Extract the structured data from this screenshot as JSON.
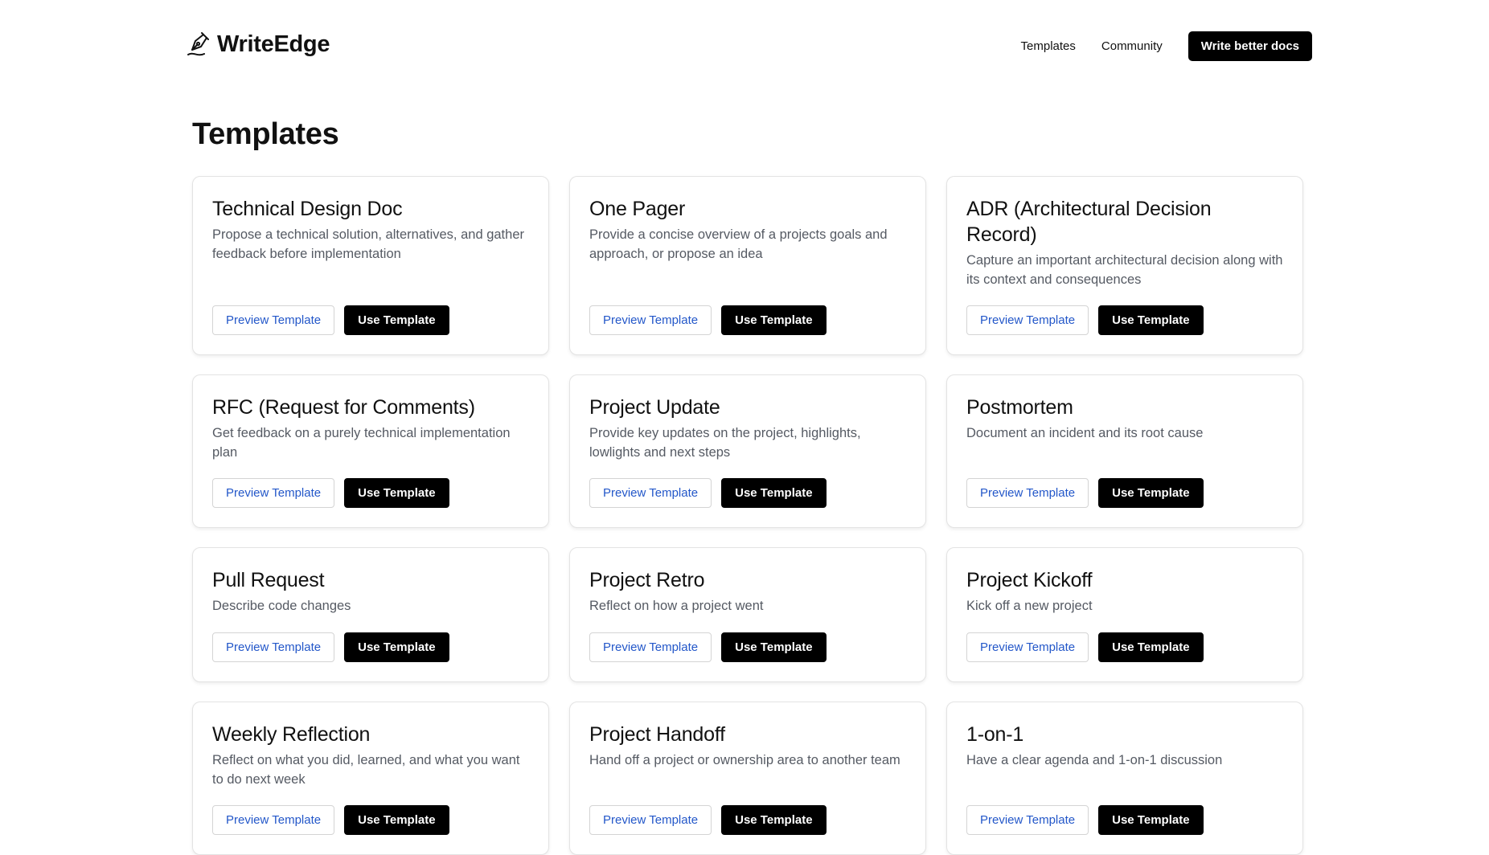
{
  "brand": {
    "name": "WriteEdge",
    "icon": "pen-nib-icon"
  },
  "nav": {
    "links": [
      {
        "label": "Templates"
      },
      {
        "label": "Community"
      }
    ],
    "cta_label": "Write better docs"
  },
  "page": {
    "title": "Templates"
  },
  "colors": {
    "accent_link": "#2357c9",
    "primary_button": "#000000",
    "description_text": "#555a63"
  },
  "templates": [
    {
      "title": "Technical Design Doc",
      "description": "Propose a technical solution, alternatives, and gather feedback before implementation",
      "preview_label": "Preview Template",
      "use_label": "Use Template"
    },
    {
      "title": "One Pager",
      "description": "Provide a concise overview of a projects goals and approach, or propose an idea",
      "preview_label": "Preview Template",
      "use_label": "Use Template"
    },
    {
      "title": "ADR (Architectural Decision Record)",
      "description": "Capture an important architectural decision along with its context and consequences",
      "preview_label": "Preview Template",
      "use_label": "Use Template"
    },
    {
      "title": "RFC (Request for Comments)",
      "description": "Get feedback on a purely technical implementation plan",
      "preview_label": "Preview Template",
      "use_label": "Use Template"
    },
    {
      "title": "Project Update",
      "description": "Provide key updates on the project, highlights, lowlights and next steps",
      "preview_label": "Preview Template",
      "use_label": "Use Template"
    },
    {
      "title": "Postmortem",
      "description": "Document an incident and its root cause",
      "preview_label": "Preview Template",
      "use_label": "Use Template"
    },
    {
      "title": "Pull Request",
      "description": "Describe code changes",
      "preview_label": "Preview Template",
      "use_label": "Use Template"
    },
    {
      "title": "Project Retro",
      "description": "Reflect on how a project went",
      "preview_label": "Preview Template",
      "use_label": "Use Template"
    },
    {
      "title": "Project Kickoff",
      "description": "Kick off a new project",
      "preview_label": "Preview Template",
      "use_label": "Use Template"
    },
    {
      "title": "Weekly Reflection",
      "description": "Reflect on what you did, learned, and what you want to do next week",
      "preview_label": "Preview Template",
      "use_label": "Use Template"
    },
    {
      "title": "Project Handoff",
      "description": "Hand off a project or ownership area to another team",
      "preview_label": "Preview Template",
      "use_label": "Use Template"
    },
    {
      "title": "1-on-1",
      "description": "Have a clear agenda and 1-on-1 discussion",
      "preview_label": "Preview Template",
      "use_label": "Use Template"
    }
  ]
}
